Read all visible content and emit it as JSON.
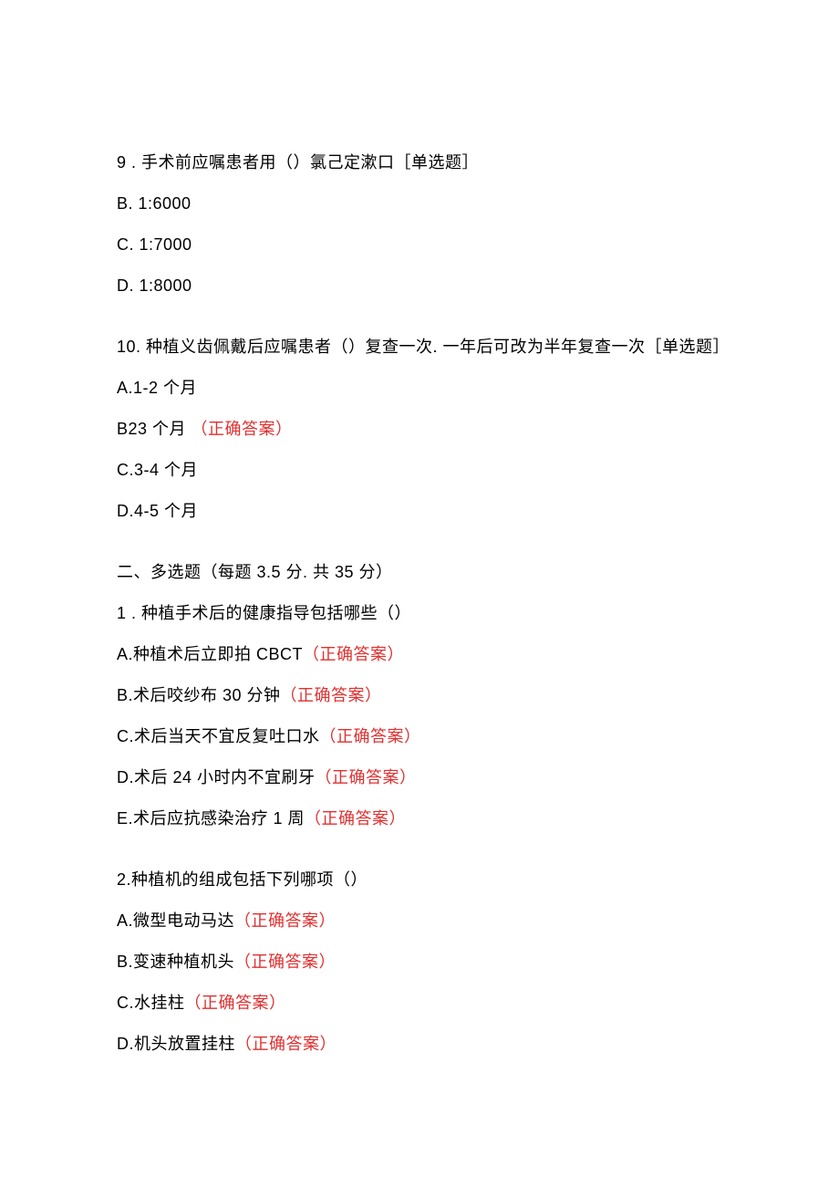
{
  "q9": {
    "number_text": "9 . 手术前应嘱患者用（）氯己定漱口［单选题］",
    "options": {
      "b": "B.   1:6000",
      "c": "C.   1:7000",
      "d": "D.   1:8000"
    }
  },
  "q10": {
    "text": "10. 种植义齿佩戴后应嘱患者（）复查一次. 一年后可改为半年复查一次［单选题］",
    "options": {
      "a": "A.1-2 个月",
      "b_prefix": "B23 个月 ",
      "c": "C.3-4 个月",
      "d": "D.4-5 个月"
    }
  },
  "section2": {
    "header": "二、多选题（每题 3.5 分. 共 35 分）"
  },
  "mq1": {
    "text": "1 . 种植手术后的健康指导包括哪些（）",
    "options": {
      "a_prefix": "A.种植术后立即拍 CBCT",
      "b_prefix": "B.术后咬纱布 30 分钟",
      "c_prefix": "C.术后当天不宜反复吐口水",
      "d_prefix": "D.术后 24 小时内不宜刷牙",
      "e_prefix": "E.术后应抗感染治疗 1 周"
    }
  },
  "mq2": {
    "text": "2.种植机的组成包括下列哪项（）",
    "options": {
      "a_prefix": "A.微型电动马达",
      "b_prefix": "B.变速种植机头",
      "c_prefix": "C.水挂柱",
      "d_prefix": "D.机头放置挂柱"
    }
  },
  "correct_label": "（正确答案）"
}
